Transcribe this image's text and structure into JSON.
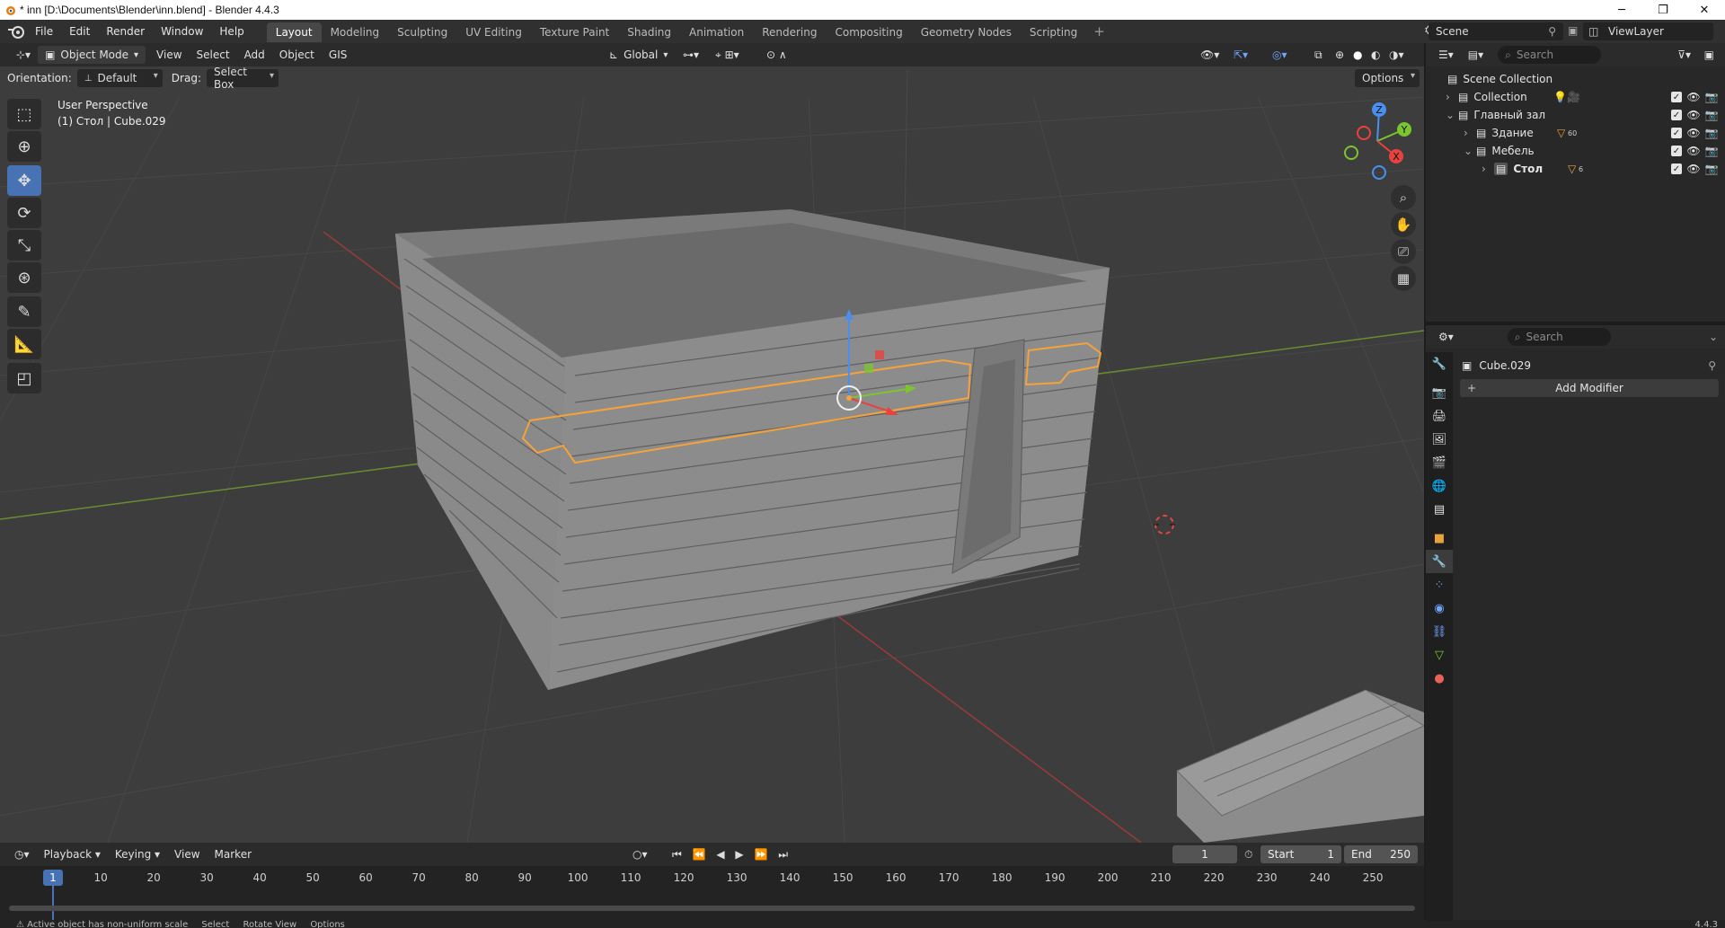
{
  "window": {
    "title": "* inn [D:\\Documents\\Blender\\inn.blend] - Blender 4.4.3",
    "minimize": "─",
    "maximize": "❐",
    "close": "✕"
  },
  "menu": [
    "File",
    "Edit",
    "Render",
    "Window",
    "Help"
  ],
  "workspaces": [
    {
      "label": "Layout",
      "active": true
    },
    {
      "label": "Modeling"
    },
    {
      "label": "Sculpting"
    },
    {
      "label": "UV Editing"
    },
    {
      "label": "Texture Paint"
    },
    {
      "label": "Shading"
    },
    {
      "label": "Animation"
    },
    {
      "label": "Rendering"
    },
    {
      "label": "Compositing"
    },
    {
      "label": "Geometry Nodes"
    },
    {
      "label": "Scripting"
    }
  ],
  "add_workspace": "+",
  "scene": {
    "name": "Scene",
    "view_layer": "ViewLayer"
  },
  "viewport": {
    "mode": "Object Mode",
    "menus": [
      "View",
      "Select",
      "Add",
      "Object",
      "GIS"
    ],
    "transform_orientation": "Global",
    "orientation_label": "Orientation:",
    "orientation_value": "Default",
    "drag_label": "Drag:",
    "drag_value": "Select Box",
    "options": "Options",
    "perspective": "User Perspective",
    "active_object": "(1) Стол | Cube.029",
    "gizmo_axes": [
      "Z",
      "Y",
      "X"
    ]
  },
  "timeline": {
    "menus": [
      "Playback",
      "Keying",
      "View",
      "Marker"
    ],
    "current_frame": "1",
    "start_label": "Start",
    "start": "1",
    "end_label": "End",
    "end": "250",
    "ruler": [
      "1",
      "10",
      "20",
      "30",
      "40",
      "50",
      "60",
      "70",
      "80",
      "90",
      "100",
      "110",
      "120",
      "130",
      "140",
      "150",
      "160",
      "170",
      "180",
      "190",
      "200",
      "210",
      "220",
      "230",
      "240",
      "250"
    ]
  },
  "status": {
    "message": "Active object has non-uniform scale",
    "hints": [
      "Select",
      "Rotate View",
      "Options"
    ],
    "version": "4.4.3"
  },
  "outliner": {
    "search_placeholder": "Search",
    "rows": [
      {
        "label": "Scene Collection",
        "indent": 0
      },
      {
        "label": "Collection",
        "indent": 1
      },
      {
        "label": "Главный зал",
        "indent": 1
      },
      {
        "label": "Здание",
        "indent": 2,
        "badge": "60"
      },
      {
        "label": "Мебель",
        "indent": 2
      },
      {
        "label": "Стол",
        "indent": 3,
        "badge": "6"
      }
    ]
  },
  "properties": {
    "search_placeholder": "Search",
    "object_name": "Cube.029",
    "add_modifier": "Add Modifier"
  },
  "colors": {
    "selection_outline": "#f5a23a",
    "active_blue": "#4772b3",
    "viewport_bg": "#3d3d3d"
  }
}
